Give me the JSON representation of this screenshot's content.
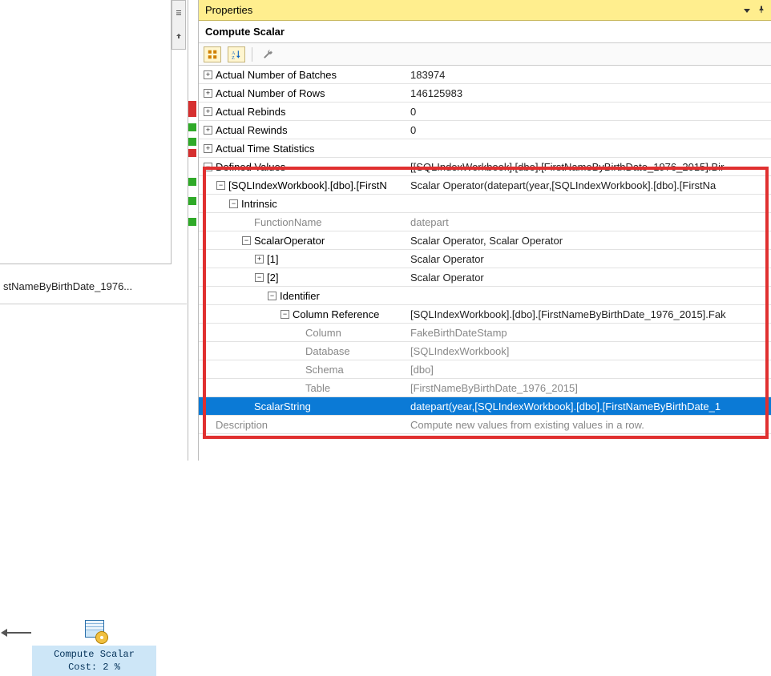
{
  "properties": {
    "title": "Properties",
    "subtitle": "Compute Scalar"
  },
  "query_plan": {
    "row_source_label": "stNameByBirthDate_1976...",
    "operator": {
      "name": "Compute Scalar",
      "cost_line": "Cost: 2 %"
    }
  },
  "rows": [
    {
      "indent": 0,
      "expander": "plus",
      "label": "Actual Number of Batches",
      "value": "183974"
    },
    {
      "indent": 0,
      "expander": "plus",
      "label": "Actual Number of Rows",
      "value": "146125983"
    },
    {
      "indent": 0,
      "expander": "plus",
      "label": "Actual Rebinds",
      "value": "0"
    },
    {
      "indent": 0,
      "expander": "plus",
      "label": "Actual Rewinds",
      "value": "0"
    },
    {
      "indent": 0,
      "expander": "plus",
      "label": "Actual Time Statistics",
      "value": ""
    },
    {
      "indent": 0,
      "expander": "minus",
      "label": "Defined Values",
      "value": "[[SQLIndexWorkbook].[dbo].[FirstNameByBirthDate_1976_2015].Bir"
    },
    {
      "indent": 1,
      "expander": "minus",
      "label": "[SQLIndexWorkbook].[dbo].[FirstN",
      "value": "Scalar Operator(datepart(year,[SQLIndexWorkbook].[dbo].[FirstNa"
    },
    {
      "indent": 2,
      "expander": "minus",
      "label": "Intrinsic",
      "value": ""
    },
    {
      "indent": 3,
      "expander": "none",
      "label": "FunctionName",
      "value": "datepart",
      "dim": true
    },
    {
      "indent": 3,
      "expander": "minus",
      "label": "ScalarOperator",
      "value": "Scalar Operator, Scalar Operator"
    },
    {
      "indent": 4,
      "expander": "plus",
      "label": "[1]",
      "value": "Scalar Operator"
    },
    {
      "indent": 4,
      "expander": "minus",
      "label": "[2]",
      "value": "Scalar Operator"
    },
    {
      "indent": 5,
      "expander": "minus",
      "label": "Identifier",
      "value": ""
    },
    {
      "indent": 6,
      "expander": "minus",
      "label": "Column Reference",
      "value": "[SQLIndexWorkbook].[dbo].[FirstNameByBirthDate_1976_2015].Fak"
    },
    {
      "indent": 7,
      "expander": "none",
      "label": "Column",
      "value": "FakeBirthDateStamp",
      "dim": true
    },
    {
      "indent": 7,
      "expander": "none",
      "label": "Database",
      "value": "[SQLIndexWorkbook]",
      "dim": true
    },
    {
      "indent": 7,
      "expander": "none",
      "label": "Schema",
      "value": "[dbo]",
      "dim": true
    },
    {
      "indent": 7,
      "expander": "none",
      "label": "Table",
      "value": "[FirstNameByBirthDate_1976_2015]",
      "dim": true
    },
    {
      "indent": 3,
      "expander": "none",
      "label": "ScalarString",
      "value": "datepart(year,[SQLIndexWorkbook].[dbo].[FirstNameByBirthDate_1",
      "selected": true
    },
    {
      "indent": 0,
      "expander": "blank",
      "label": "Description",
      "value": "Compute new values from existing values in a row.",
      "dim": true
    }
  ]
}
